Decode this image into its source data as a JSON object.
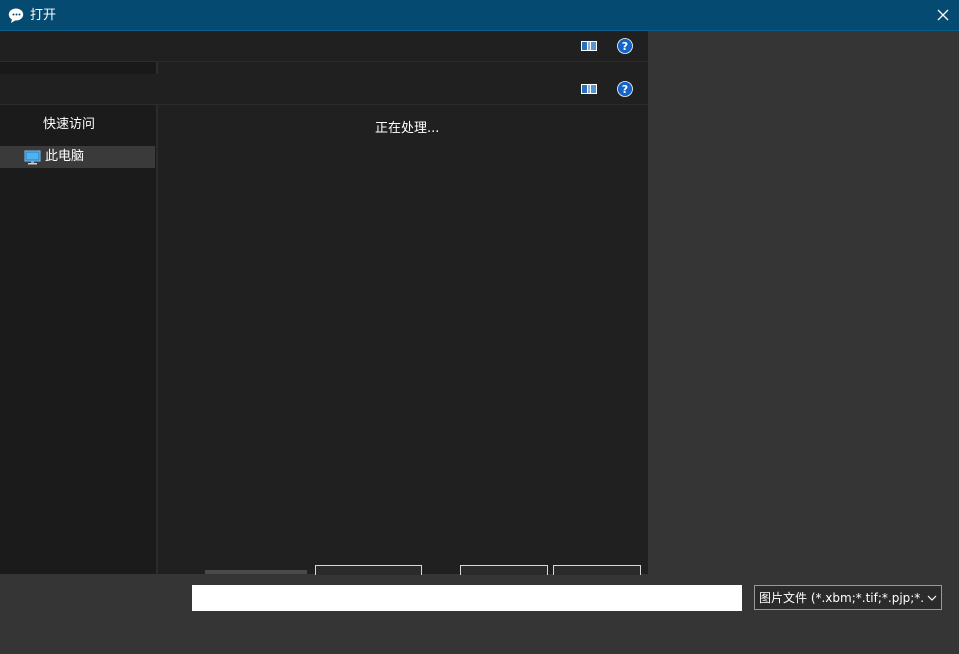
{
  "window": {
    "title": "打开",
    "app_icon": "chat-bubble-icon",
    "close_icon": "close-icon",
    "titlebar_color": "#054a71"
  },
  "toolbar": {
    "view_icon": "view-toggle-icon",
    "help_icon": "help-icon",
    "help_color": "#1464c8"
  },
  "nav": {
    "quick_access": "快速访问",
    "items": [
      {
        "label": "此电脑",
        "icon": "computer-icon",
        "selected": true
      }
    ]
  },
  "content": {
    "status": "正在处理..."
  },
  "footer": {
    "filename_value": "",
    "file_type_filter": "图片文件 (*.xbm;*.tif;*.pjp;*.svgz;*.jpg;*.jpeg;*.ico;*.tiff;*.gif;*.svg;*.jfif;*.webp;*.png;*.bmp;*.pjpeg;*.avif)",
    "dropdown_icon": "chevron-down-icon"
  }
}
